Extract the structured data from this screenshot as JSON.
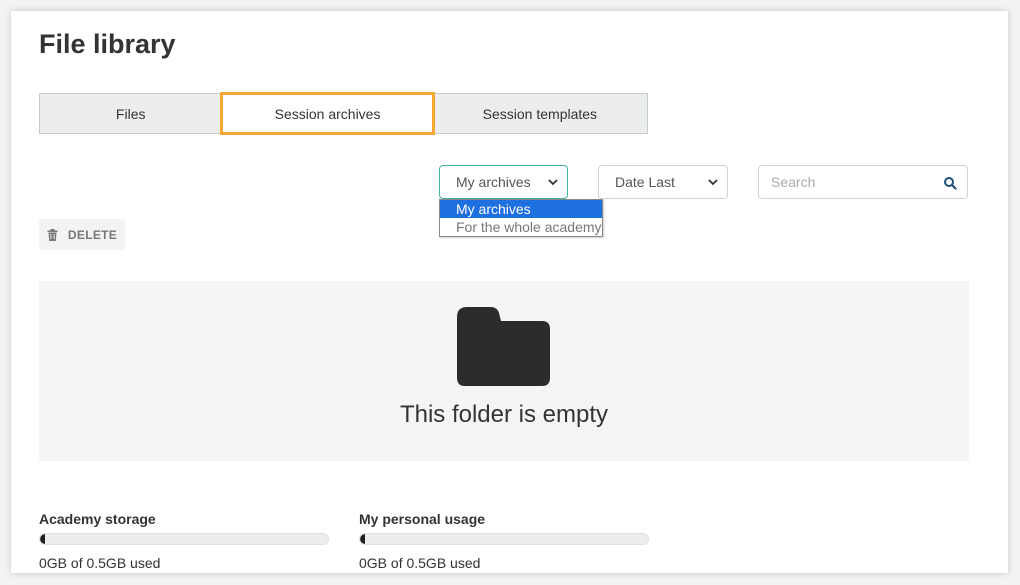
{
  "page": {
    "title": "File library"
  },
  "tabs": [
    {
      "label": "Files",
      "active": false
    },
    {
      "label": "Session archives",
      "active": true
    },
    {
      "label": "Session templates",
      "active": false
    }
  ],
  "filters": {
    "archives_select": {
      "value": "My archives",
      "options": [
        "My archives",
        "For the whole academy"
      ],
      "selected_index": 0,
      "open": true
    },
    "date_select": {
      "value": "Date Last"
    },
    "search": {
      "placeholder": "Search",
      "icon": "search-icon"
    }
  },
  "toolbar": {
    "delete_label": "DELETE",
    "delete_icon": "trash-icon"
  },
  "empty_state": {
    "icon": "folder-icon",
    "message": "This folder is empty"
  },
  "storage": {
    "academy": {
      "label": "Academy storage",
      "used_text": "0GB of 0.5GB used",
      "usage_fraction": 0
    },
    "personal": {
      "label": "My personal usage",
      "used_text": "0GB of 0.5GB used",
      "usage_fraction": 0
    }
  },
  "colors": {
    "accent_outline": "#f5a733",
    "select_focus": "#3fb39f",
    "dropdown_highlight": "#1e6fe0",
    "search_icon": "#1f4f7a"
  }
}
